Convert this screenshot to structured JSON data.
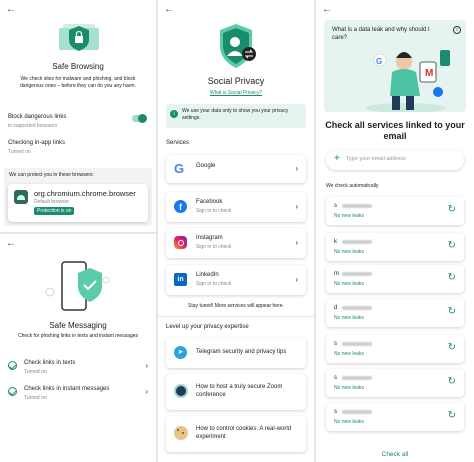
{
  "safe_browsing": {
    "title": "Safe Browsing",
    "description": "We check sites for malware and phishing, and block dangerous ones – before they can do you any harm.",
    "block_label": "Block dangerous links",
    "block_sub": "in supported browsers",
    "inapp_label": "Checking in-app links",
    "inapp_sub": "Turned on",
    "protect_heading": "We can protect you in these browsers:",
    "browser_name": "org.chromium.chrome.browser",
    "browser_sub": "Default browser",
    "browser_badge": "Protection is on",
    "block_toggle_on": true
  },
  "safe_messaging": {
    "title": "Safe Messaging",
    "description": "Check for phishing links in texts and instant messages",
    "items": [
      {
        "label": "Check links in texts",
        "sub": "Turned on"
      },
      {
        "label": "Check links in instant messages",
        "sub": "Turned on"
      }
    ]
  },
  "social_privacy": {
    "title": "Social Privacy",
    "link": "What is Social Privacy?",
    "info": "We use your data only to show you your privacy settings.",
    "services_heading": "Services",
    "services": [
      {
        "name": "Google",
        "sub": ""
      },
      {
        "name": "Facebook",
        "sub": "Sign in to check"
      },
      {
        "name": "Instagram",
        "sub": "Sign in to check"
      },
      {
        "name": "LinkedIn",
        "sub": "Sign in to check"
      }
    ],
    "stay_tuned": "Stay tuned! More services will appear here.",
    "level_heading": "Level up your privacy expertise",
    "articles": [
      "Telegram security and privacy tips",
      "How to host a truly secure Zoom conference",
      "How to control cookies: A real-world experiment"
    ]
  },
  "data_leak": {
    "banner_text": "What is a data leak and why should I care?",
    "title": "Check all services linked to your email",
    "input_placeholder": "Type your email address",
    "auto_heading": "We check automatically",
    "status_label": "No new leaks",
    "accounts": [
      "s",
      "k",
      "m",
      "d",
      "s",
      "s",
      "s"
    ],
    "check_all": "Check all"
  },
  "colors": {
    "accent": "#1a8c6e",
    "link": "#1a8c6e"
  }
}
